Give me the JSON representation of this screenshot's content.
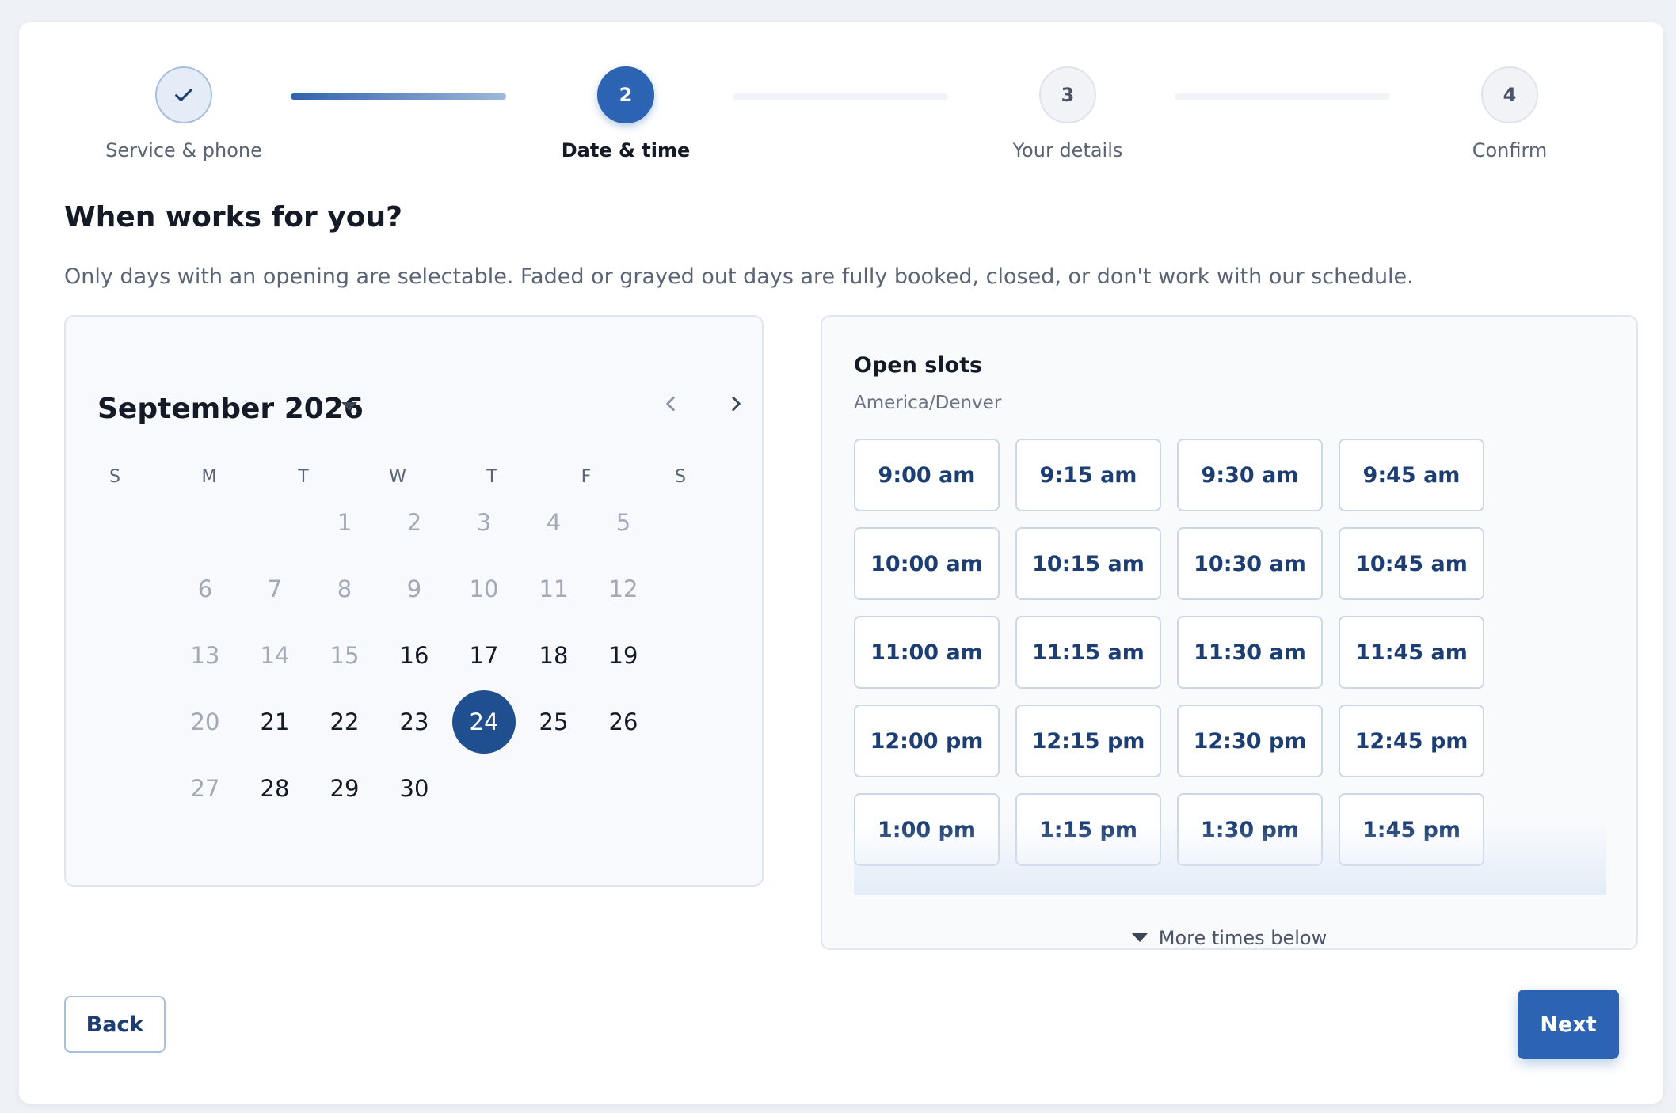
{
  "stepper": {
    "steps": [
      {
        "number": "",
        "label": "Service & phone",
        "state": "done",
        "icon": "check-icon"
      },
      {
        "number": "2",
        "label": "Date & time",
        "state": "active"
      },
      {
        "number": "3",
        "label": "Your details",
        "state": "upcoming"
      },
      {
        "number": "4",
        "label": "Confirm",
        "state": "upcoming"
      }
    ]
  },
  "heading": "When works for you?",
  "subheading": "Only days with an opening are selectable. Faded or grayed out days are fully booked, closed, or don't work with our schedule.",
  "calendar": {
    "month_label": "September 2026",
    "month_dropdown_icon": "caret-down-icon",
    "prev_icon": "chevron-left-icon",
    "next_icon": "chevron-right-icon",
    "weekdays": [
      "S",
      "M",
      "T",
      "W",
      "T",
      "F",
      "S"
    ],
    "selected_day": "24",
    "weeks": [
      [
        null,
        null,
        {
          "d": "1",
          "s": "off"
        },
        {
          "d": "2",
          "s": "off"
        },
        {
          "d": "3",
          "s": "off"
        },
        {
          "d": "4",
          "s": "off"
        },
        {
          "d": "5",
          "s": "off"
        }
      ],
      [
        {
          "d": "6",
          "s": "off"
        },
        {
          "d": "7",
          "s": "off"
        },
        {
          "d": "8",
          "s": "off"
        },
        {
          "d": "9",
          "s": "off"
        },
        {
          "d": "10",
          "s": "off"
        },
        {
          "d": "11",
          "s": "off"
        },
        {
          "d": "12",
          "s": "off"
        }
      ],
      [
        {
          "d": "13",
          "s": "off"
        },
        {
          "d": "14",
          "s": "off"
        },
        {
          "d": "15",
          "s": "off"
        },
        {
          "d": "16",
          "s": "on"
        },
        {
          "d": "17",
          "s": "on"
        },
        {
          "d": "18",
          "s": "on"
        },
        {
          "d": "19",
          "s": "on"
        }
      ],
      [
        {
          "d": "20",
          "s": "off"
        },
        {
          "d": "21",
          "s": "on"
        },
        {
          "d": "22",
          "s": "on"
        },
        {
          "d": "23",
          "s": "on"
        },
        {
          "d": "24",
          "s": "sel"
        },
        {
          "d": "25",
          "s": "on"
        },
        {
          "d": "26",
          "s": "on"
        }
      ],
      [
        {
          "d": "27",
          "s": "off"
        },
        {
          "d": "28",
          "s": "on"
        },
        {
          "d": "29",
          "s": "on"
        },
        {
          "d": "30",
          "s": "on"
        },
        null,
        null,
        null
      ]
    ]
  },
  "slots": {
    "title": "Open slots",
    "timezone": "America/Denver",
    "times": [
      "9:00 am",
      "9:15 am",
      "9:30 am",
      "9:45 am",
      "10:00 am",
      "10:15 am",
      "10:30 am",
      "10:45 am",
      "11:00 am",
      "11:15 am",
      "11:30 am",
      "11:45 am",
      "12:00 pm",
      "12:15 pm",
      "12:30 pm",
      "12:45 pm",
      "1:00 pm",
      "1:15 pm",
      "1:30 pm",
      "1:45 pm"
    ],
    "more_label": "More times below"
  },
  "actions": {
    "back_label": "Back",
    "next_label": "Next"
  },
  "colors": {
    "accent": "#2c64b3",
    "selected_day": "#1f4f8f",
    "slot_text": "#1d3e73"
  }
}
